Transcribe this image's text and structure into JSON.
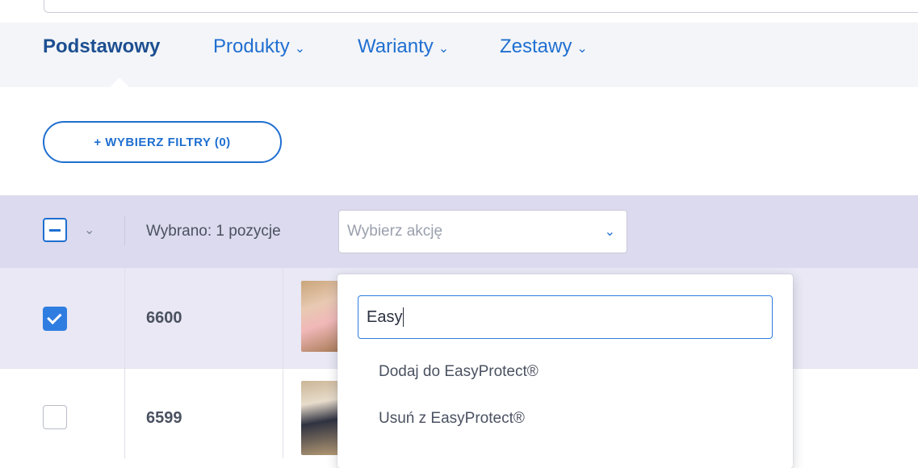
{
  "tabs": [
    {
      "label": "Podstawowy",
      "active": true
    },
    {
      "label": "Produkty",
      "active": false
    },
    {
      "label": "Warianty",
      "active": false
    },
    {
      "label": "Zestawy",
      "active": false
    }
  ],
  "filters": {
    "button_label": "+ WYBIERZ FILTRY (0)"
  },
  "bulk": {
    "selected_text": "Wybrano: 1 pozycje",
    "action_placeholder": "Wybierz akcję"
  },
  "rows": [
    {
      "id": "6600",
      "checked": true
    },
    {
      "id": "6599",
      "checked": false
    }
  ],
  "dropdown": {
    "search_value": "Easy",
    "options": [
      "Dodaj do EasyProtect®",
      "Usuń z EasyProtect®"
    ]
  },
  "colors": {
    "accent": "#1f6fd1",
    "action_bar": "#dcdaee",
    "selected_row": "#e9e8f4"
  }
}
